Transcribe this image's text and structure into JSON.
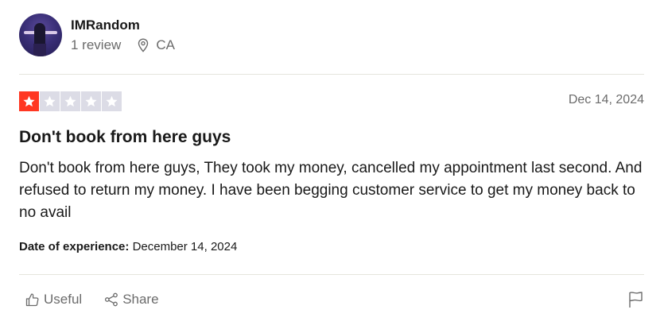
{
  "reviewer": {
    "name": "IMRandom",
    "review_count": "1 review",
    "location": "CA"
  },
  "review": {
    "rating": 1,
    "max_rating": 5,
    "date": "Dec 14, 2024",
    "title": "Don't book from here guys",
    "body": "Don't book from here guys, They took my money, cancelled my appointment last second. And refused to return my money. I have been begging customer service to get my money back to no avail",
    "experience_label": "Date of experience:",
    "experience_date": "December 14, 2024"
  },
  "actions": {
    "useful_label": "Useful",
    "share_label": "Share"
  },
  "colors": {
    "star_on": "#ff3722",
    "star_off": "#dcdce6",
    "muted_text": "#6b6b6b"
  },
  "icons": [
    "map-pin-icon",
    "star-icon",
    "thumbs-up-icon",
    "share-icon",
    "flag-icon"
  ]
}
